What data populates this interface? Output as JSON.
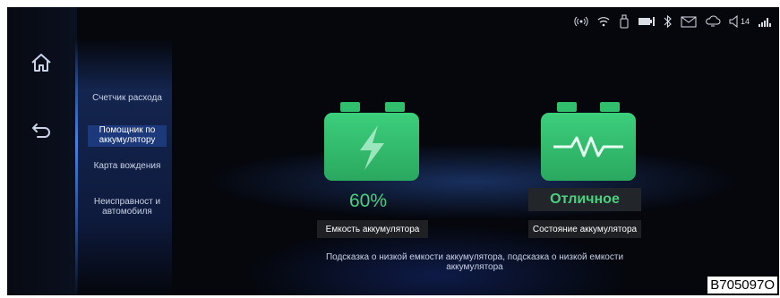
{
  "status_bar": {
    "icons": [
      "hotspot-icon",
      "wifi-icon",
      "usb-icon",
      "battery-status-icon",
      "bluetooth-icon",
      "message-icon",
      "cloud-icon",
      "volume-icon",
      "signal-icon"
    ],
    "volume_level": "14"
  },
  "left_rail": {
    "icons": [
      "home-icon",
      "back-icon"
    ]
  },
  "menu": {
    "items": [
      {
        "label": "Счетчик расхода"
      },
      {
        "label": "Помощник по аккумулятору"
      },
      {
        "label": "Карта вождения"
      },
      {
        "label": "Неисправност и автомобиля"
      }
    ],
    "active_index": 1
  },
  "capacity": {
    "value": "60%",
    "label": "Емкость аккумулятора"
  },
  "health": {
    "value": "Отличное",
    "label": "Состояние аккумулятора"
  },
  "hint": {
    "text": "Подсказка о низкой емкости аккумулятора, подсказка о низкой емкости аккумулятора"
  },
  "figure_code": "B705097O",
  "colors": {
    "accent_green": "#3ccf7c",
    "background": "#05070d",
    "panel_blue": "#1c3a80"
  }
}
